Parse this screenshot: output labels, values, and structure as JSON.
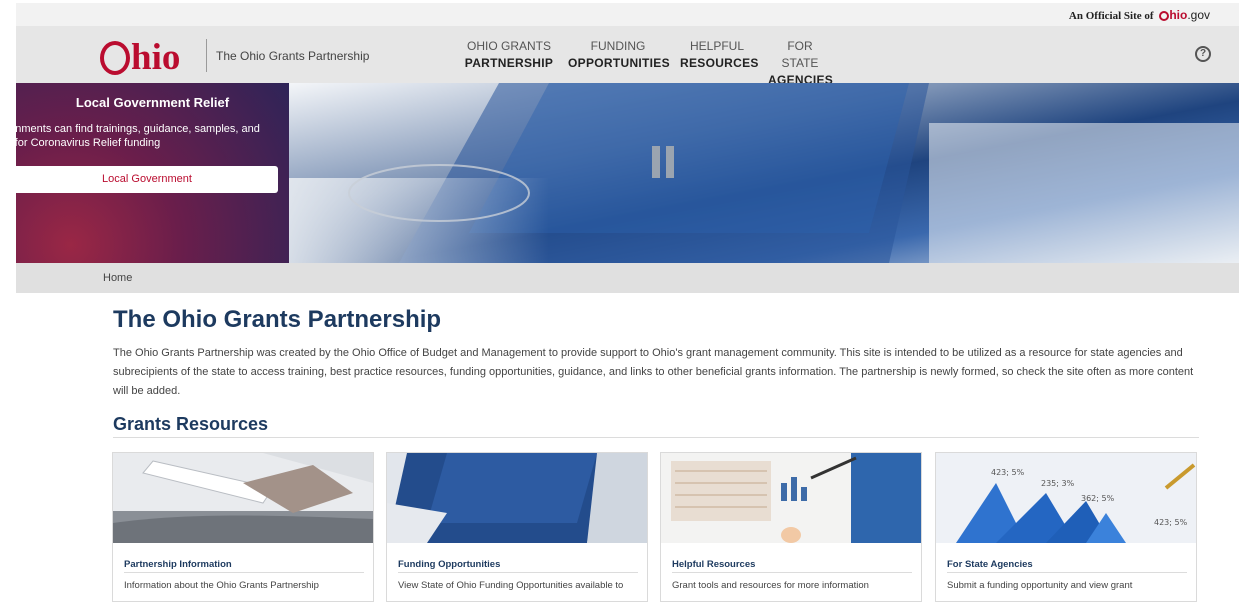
{
  "official": {
    "prefix": "An Official Site of",
    "brand_rest": "hio",
    "tld": ".gov"
  },
  "header": {
    "logo_text": "hio",
    "site_name": "The Ohio Grants Partnership",
    "nav": [
      {
        "line1": "Ohio Grants",
        "line2": "Partnership"
      },
      {
        "line1": "Funding",
        "line2": "Opportunities"
      },
      {
        "line1": "Helpful",
        "line2": "Resources"
      },
      {
        "line1": "For State",
        "line2": "Agencies"
      }
    ],
    "help_glyph": "?"
  },
  "hero": {
    "title": "Local Government Relief",
    "description_line1": "vernments can find trainings, guidance, samples, and",
    "description_line2": "es for Coronavirus Relief funding",
    "button_label": "Local Government"
  },
  "breadcrumb": {
    "home": "Home"
  },
  "main": {
    "title": "The Ohio Grants Partnership",
    "intro": "The Ohio Grants Partnership was created by the Ohio Office of Budget and Management to provide support to Ohio's grant management community. This site is intended to be utilized as a resource for state agencies and subrecipients of the state to access training, best practice resources, funding opportunities, guidance, and links to other beneficial grants information. The partnership is newly formed, so check the site often as more content will be added.",
    "section_title": "Grants Resources"
  },
  "cards": [
    {
      "title": "Partnership Information",
      "desc": "Information about the Ohio Grants Partnership"
    },
    {
      "title": "Funding Opportunities",
      "desc": "View State of Ohio Funding Opportunities available to"
    },
    {
      "title": "Helpful Resources",
      "desc": "Grant tools and resources for more information"
    },
    {
      "title": "For State Agencies",
      "desc": "Submit a funding opportunity and view grant"
    }
  ],
  "chart_labels": [
    "423; 5%",
    "235; 3%",
    "362; 5%",
    "423; 5%"
  ],
  "colors": {
    "brand_red": "#ba0c2f",
    "navy": "#1d3a5f",
    "header_gray": "#e6e6e6"
  }
}
